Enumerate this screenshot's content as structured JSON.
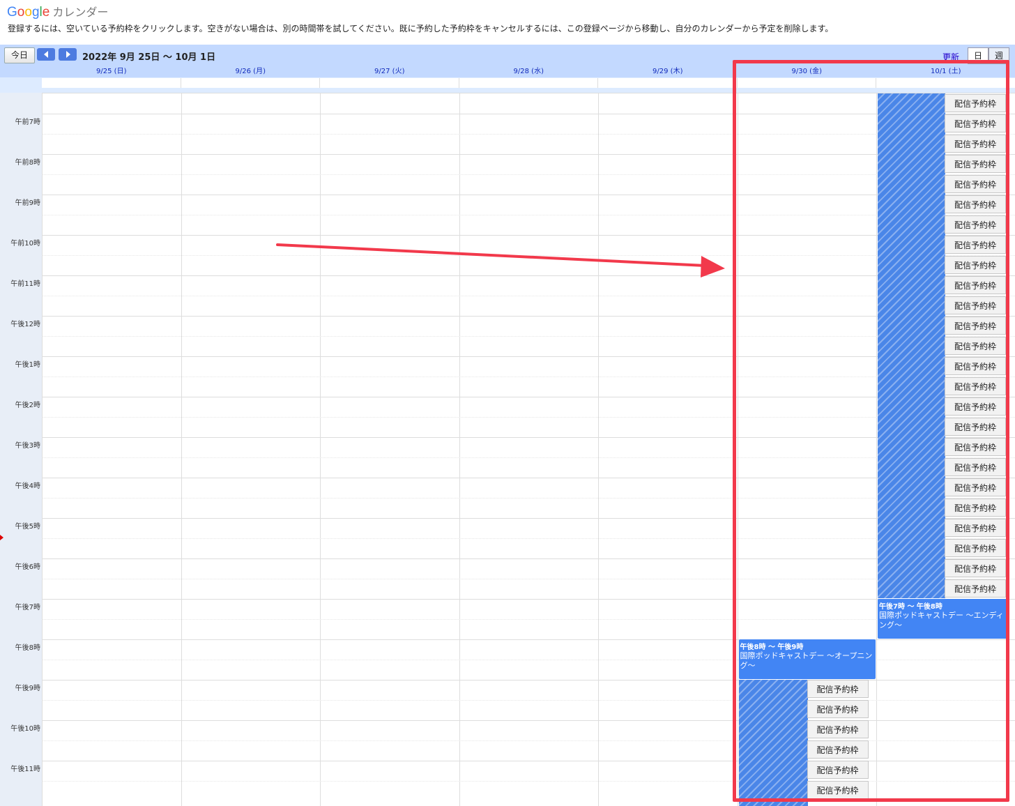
{
  "header": {
    "logo_text": "Google",
    "app_name": "カレンダー",
    "instructions": "登録するには、空いている予約枠をクリックします。空きがない場合は、別の時間帯を試してください。既に予約した予約枠をキャンセルするには、この登録ページから移動し、自分のカレンダーから予定を削除します。"
  },
  "toolbar": {
    "today_label": "今日",
    "date_range": "2022年 9月 25日 〜 10月 1日",
    "refresh_label": "更新",
    "view_day_label": "日",
    "view_week_label": "週"
  },
  "days": [
    "9/25 (日)",
    "9/26 (月)",
    "9/27 (火)",
    "9/28 (水)",
    "9/29 (木)",
    "9/30 (金)",
    "10/1 (土)"
  ],
  "hours": [
    "午前7時",
    "午前8時",
    "午前9時",
    "午前10時",
    "午前11時",
    "午後12時",
    "午後1時",
    "午後2時",
    "午後3時",
    "午後4時",
    "午後5時",
    "午後6時",
    "午後7時",
    "午後8時",
    "午後9時",
    "午後10時",
    "午後11時"
  ],
  "slot_label": "配信予約枠",
  "events": [
    {
      "time": "午後7時 〜 午後8時",
      "title": "国際ポッドキャストデー 〜エンディング〜"
    },
    {
      "time": "午後8時 〜 午後9時",
      "title": "国際ポッドキャストデー 〜オープニング〜"
    }
  ],
  "colors": {
    "accent": "#4285f4",
    "highlight": "#f2394b",
    "nav": "#c3d9ff"
  }
}
